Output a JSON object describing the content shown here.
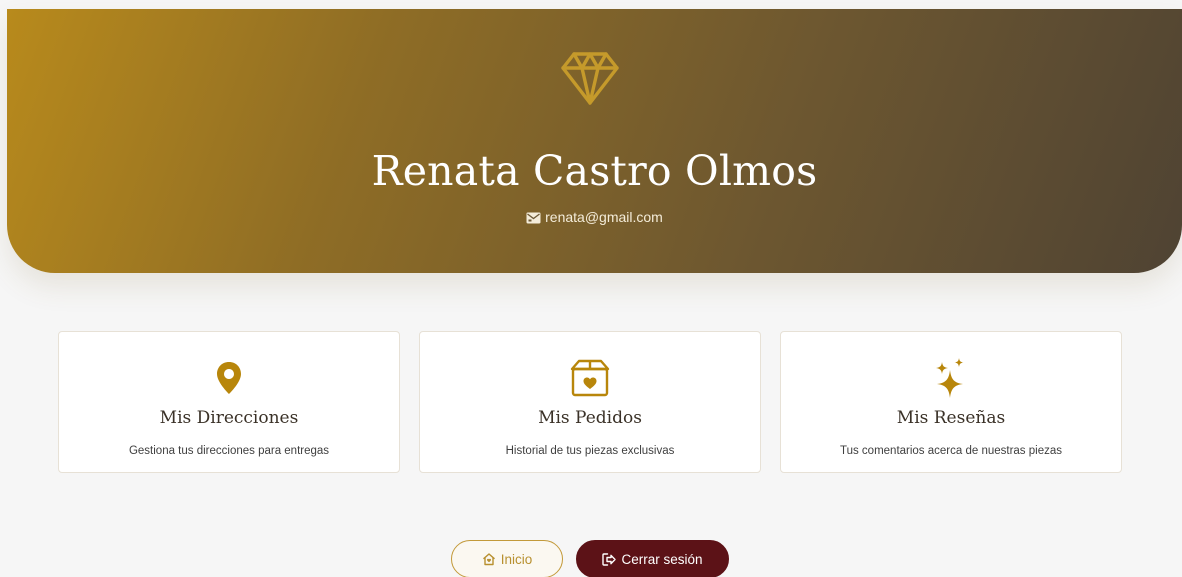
{
  "profile": {
    "name": "Renata Castro Olmos",
    "email": "renata@gmail.com",
    "logo_icon": "diamond-icon",
    "email_icon": "envelope-icon"
  },
  "cards": [
    {
      "title": "Mis Direcciones",
      "description": "Gestiona tus direcciones para entregas",
      "icon": "map-pin-icon"
    },
    {
      "title": "Mis Pedidos",
      "description": "Historial de tus piezas exclusivas",
      "icon": "gift-box-icon"
    },
    {
      "title": "Mis Reseñas",
      "description": "Tus comentarios acerca de nuestras piezas",
      "icon": "sparkles-icon"
    }
  ],
  "buttons": {
    "home_label": "Inicio",
    "home_icon": "home-icon",
    "logout_label": "Cerrar sesión",
    "logout_icon": "logout-icon"
  },
  "colors": {
    "gold": "#b8860b",
    "hero_start": "#b88a1c",
    "hero_end": "#4f4333",
    "logout_bg": "#5c1217",
    "page_bg": "#f6f6f6"
  }
}
